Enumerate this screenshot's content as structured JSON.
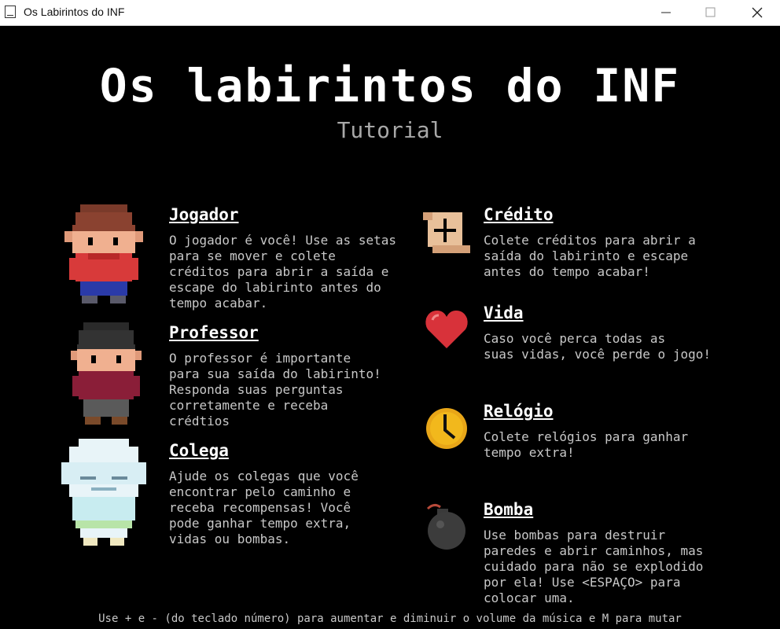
{
  "window": {
    "title": "Os Labirintos do INF"
  },
  "header": {
    "title": "Os labirintos do INF",
    "subtitle": "Tutorial"
  },
  "characters": [
    {
      "name": "Jogador",
      "icon": "player-sprite-icon",
      "description": "O jogador é você! Use as setas\npara se mover e colete\ncréditos para abrir a saída e\nescape do labirinto antes do\ntempo acabar."
    },
    {
      "name": "Professor",
      "icon": "professor-sprite-icon",
      "description": "O professor é importante\npara sua saída do labirinto!\nResponda suas perguntas\ncorretamente e receba\ncrédtios"
    },
    {
      "name": "Colega",
      "icon": "ghost-sprite-icon",
      "description": "Ajude os colegas que você\nencontrar pelo caminho e\nreceba recompensas! Você\npode ganhar tempo extra,\nvidas ou bombas."
    }
  ],
  "items": [
    {
      "name": "Crédito",
      "icon": "scroll-icon",
      "description": "Colete créditos para abrir a\nsaída do labirinto e escape\nantes do tempo acabar!"
    },
    {
      "name": "Vida",
      "icon": "heart-icon",
      "description": "Caso você perca todas as\nsuas vidas, você perde o jogo!"
    },
    {
      "name": "Relógio",
      "icon": "clock-icon",
      "description": "Colete relógios para ganhar\ntempo extra!"
    },
    {
      "name": "Bomba",
      "icon": "bomb-icon",
      "description": "Use bombas para destruir\nparedes e abrir caminhos, mas\ncuidado para não se explodido\npor ela! Use <ESPAÇO> para\ncolocar uma."
    }
  ],
  "footer": {
    "hint": "Use + e - (do teclado número) para aumentar e diminuir o volume da música e M para mutar"
  }
}
